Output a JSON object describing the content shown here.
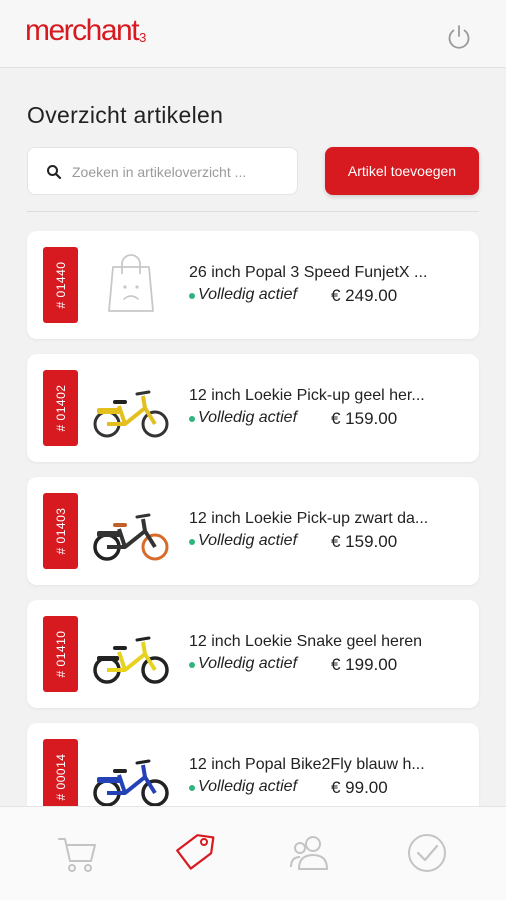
{
  "header": {
    "logo_text": "merchant",
    "logo_suffix": "3",
    "brand_color": "#d71920"
  },
  "page": {
    "title": "Overzicht artikelen"
  },
  "search": {
    "placeholder": "Zoeken in artikeloverzicht ..."
  },
  "actions": {
    "add_label": "Artikel toevoegen"
  },
  "status_color": "#2fb57c",
  "articles": [
    {
      "id": "# 01440",
      "name": "26 inch Popal 3 Speed FunjetX ...",
      "status": "Volledig actief",
      "price": "€ 249.00",
      "image": "shopping-bag-placeholder-icon"
    },
    {
      "id": "# 01402",
      "name": "12 inch Loekie Pick-up geel her...",
      "status": "Volledig actief",
      "price": "€ 159.00",
      "image": "bike-yellow-icon"
    },
    {
      "id": "# 01403",
      "name": "12 inch Loekie Pick-up zwart da...",
      "status": "Volledig actief",
      "price": "€ 159.00",
      "image": "bike-black-icon"
    },
    {
      "id": "# 01410",
      "name": "12 inch Loekie Snake geel heren",
      "status": "Volledig actief",
      "price": "€ 199.00",
      "image": "bike-yellow-black-icon"
    },
    {
      "id": "# 00014",
      "name": "12 inch Popal Bike2Fly blauw h...",
      "status": "Volledig actief",
      "price": "€ 99.00",
      "image": "bike-blue-icon"
    }
  ],
  "nav": {
    "items": [
      {
        "icon": "cart-icon",
        "active": false
      },
      {
        "icon": "tag-icon",
        "active": true
      },
      {
        "icon": "users-icon",
        "active": false
      },
      {
        "icon": "check-circle-icon",
        "active": false
      }
    ]
  }
}
